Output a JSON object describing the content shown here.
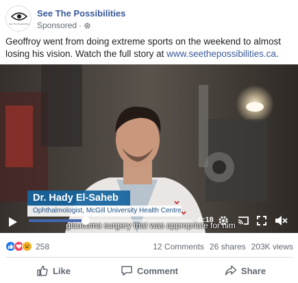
{
  "post": {
    "page_name": "See The Possibilities",
    "avatar_text": "See The Possibilities",
    "sponsored_label": "Sponsored",
    "sponsored_separator": "·",
    "body_text": "Geoffroy went from doing extreme sports on the weekend to almost losing his vision. Watch the full story at ",
    "body_link": "www.seethepossibilities.ca",
    "body_end": "."
  },
  "video": {
    "lower_third_name": "Dr. Hady El-Saheb",
    "lower_third_title": "Ophthalmologist, McGill University Health Centre",
    "time_remaining": "-0:18",
    "caption": "glaucoma surgery that was appropriate for him",
    "progress": 0.35,
    "accent_color": "#4267b2"
  },
  "stats": {
    "reaction_count": "258",
    "reaction_icons": [
      "like-icon",
      "love-icon",
      "haha-icon"
    ],
    "comments": "12 Comments",
    "shares": "26 shares",
    "views": "203K views"
  },
  "actions": {
    "like": "Like",
    "comment": "Comment",
    "share": "Share"
  }
}
